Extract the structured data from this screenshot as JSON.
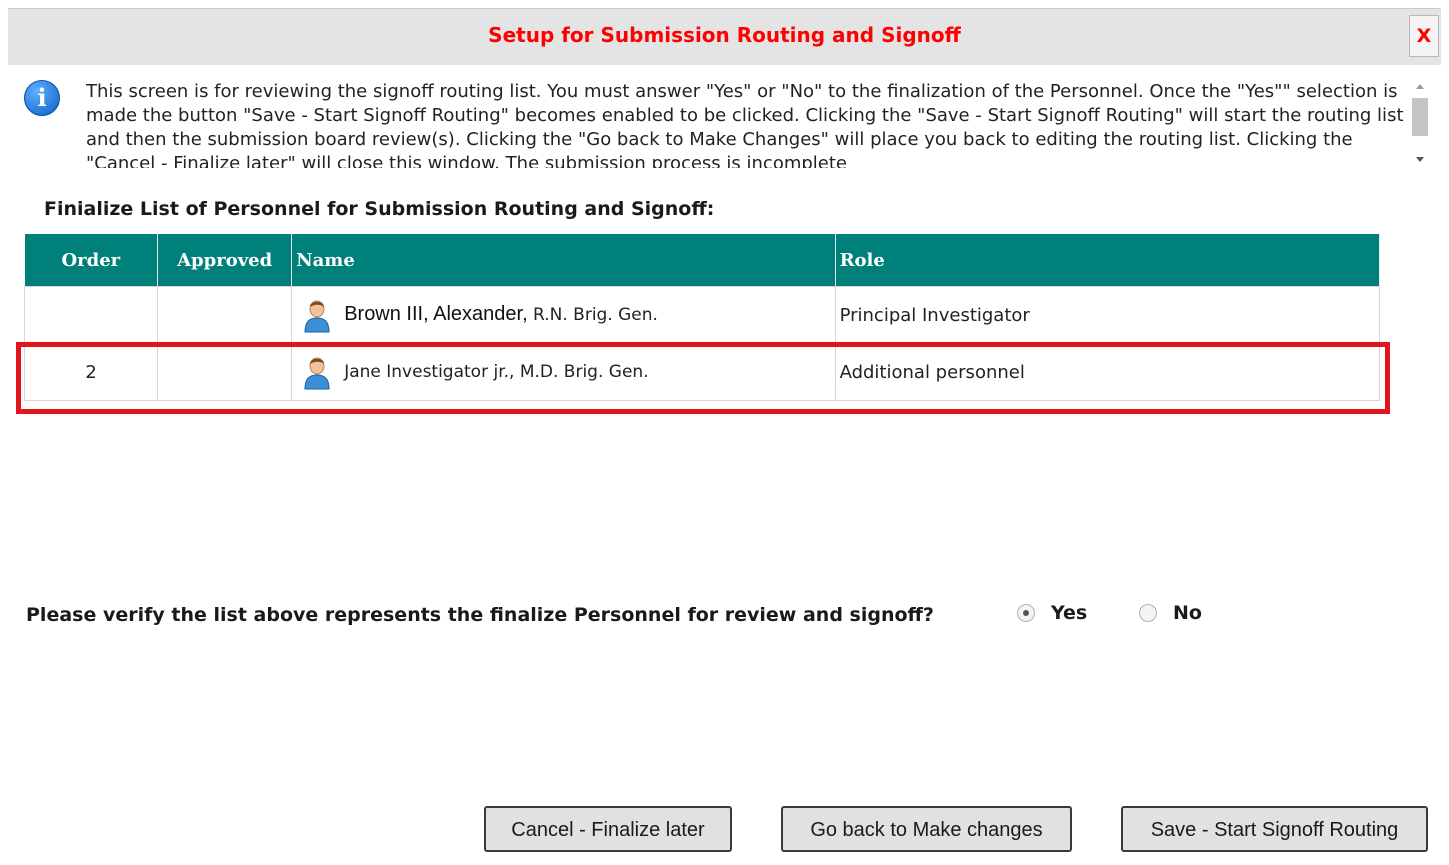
{
  "dialog": {
    "title": "Setup for Submission Routing and Signoff",
    "close_label": "X"
  },
  "info": {
    "icon": "info-icon",
    "glyph": "i",
    "text": "This screen is for reviewing the signoff routing list. You must answer \"Yes\" or \"No\" to the finalization of the Personnel. Once the \"Yes\"\" selection is made the button \"Save - Start Signoff Routing\" becomes enabled to be clicked. Clicking the \"Save - Start Signoff Routing\" will start the routing list and then the submission board review(s). Clicking the \"Go back to Make Changes\" will place you back to editing the routing list. Clicking the \"Cancel - Finalize later\" will close this window. The submission process is incomplete"
  },
  "list": {
    "heading": "Finialize List of Personnel for Submission Routing and Signoff:",
    "columns": [
      "Order",
      "Approved",
      "Name",
      "Role"
    ],
    "rows": [
      {
        "order": "",
        "approved": "",
        "name": "Brown III, Alexander,",
        "suffix": " R.N. Brig. Gen.",
        "role": "Principal Investigator"
      },
      {
        "order": "2",
        "approved": "",
        "name": "",
        "suffix": "Jane Investigator jr., M.D. Brig. Gen.",
        "role": "Additional personnel"
      }
    ]
  },
  "verify": {
    "question": "Please verify the list above represents the finalize Personnel for review and signoff?",
    "options": [
      {
        "label": "Yes",
        "checked": true
      },
      {
        "label": "No",
        "checked": false
      }
    ]
  },
  "buttons": {
    "cancel": "Cancel - Finalize later",
    "go_back": "Go back to Make changes",
    "save": "Save - Start Signoff Routing"
  },
  "colors": {
    "title": "#ff0000",
    "header_bg": "#00807a",
    "highlight": "#e0151d"
  }
}
